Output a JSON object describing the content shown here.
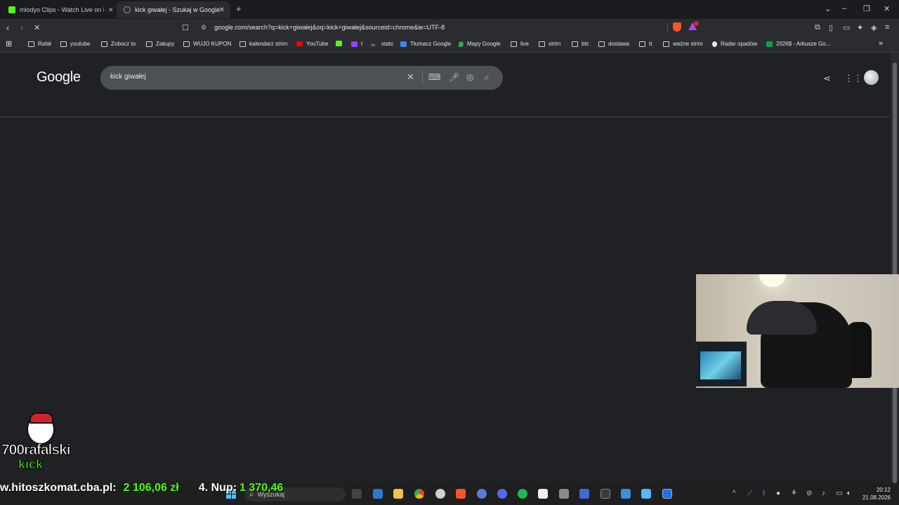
{
  "browser": {
    "tabs": [
      {
        "title": "mlodyo Clips - Watch Live on Kic",
        "favicon_color": "#53fc18",
        "active": false
      },
      {
        "title": "kick giwałej - Szukaj w Google",
        "favicon_color": "#9aa0a6",
        "active": true
      }
    ],
    "new_tab_symbol": "+",
    "window_controls": {
      "tab_search": "⌄",
      "minimize": "–",
      "restore": "❐",
      "close": "✕"
    },
    "url": "google.com/search?q=kick+giwałej&oq=kick+giwałej&sourceid=chrome&ie=UTF-8",
    "toolbar_icons": [
      "extensions-icon",
      "sidebar-icon",
      "wallet-icon",
      "leo-icon",
      "vpn-icon",
      "menu-icon"
    ]
  },
  "bookmarks": [
    {
      "label": "Rafał",
      "icon": "folder"
    },
    {
      "label": "youtube",
      "icon": "folder"
    },
    {
      "label": "Zobocz to",
      "icon": "folder"
    },
    {
      "label": "Zakupy",
      "icon": "folder"
    },
    {
      "label": "WUJO KUPON",
      "icon": "folder"
    },
    {
      "label": "kalendarz strim",
      "icon": "folder"
    },
    {
      "label": "YouTube",
      "icon": "youtube"
    },
    {
      "label": "",
      "icon": "kick"
    },
    {
      "label": "t",
      "icon": "twitch"
    },
    {
      "label": "stats",
      "icon": "stats"
    },
    {
      "label": "Tłumacz Google",
      "icon": "translate"
    },
    {
      "label": "Mapy Google",
      "icon": "maps"
    },
    {
      "label": "live",
      "icon": "folder"
    },
    {
      "label": "strim",
      "icon": "folder"
    },
    {
      "label": "btc",
      "icon": "folder"
    },
    {
      "label": "dostawa",
      "icon": "folder"
    },
    {
      "label": "tt",
      "icon": "folder"
    },
    {
      "label": "ważne strim",
      "icon": "folder"
    },
    {
      "label": "Radar opadów",
      "icon": "radar"
    },
    {
      "label": "2026$ - Arkusze Go...",
      "icon": "sheets"
    }
  ],
  "google": {
    "logo": "Google",
    "query": "kick giwałej"
  },
  "overlay": {
    "channel_name": "700rafalski",
    "channel_platform": "kick",
    "ticker_site": "w.hitoszkomat.cba.pl:",
    "ticker_amount": "2 106,06 zł",
    "ticker_label": "4. Nup:",
    "ticker_value": "1 370,46"
  },
  "taskbar": {
    "search_placeholder": "Wyszukaj",
    "time": "20:12",
    "date": "21.08.2026"
  },
  "colors": {
    "page_bg": "#202124",
    "search_bg": "#4d5156",
    "kick_green": "#53fc18",
    "brave_orange": "#fb542b"
  }
}
